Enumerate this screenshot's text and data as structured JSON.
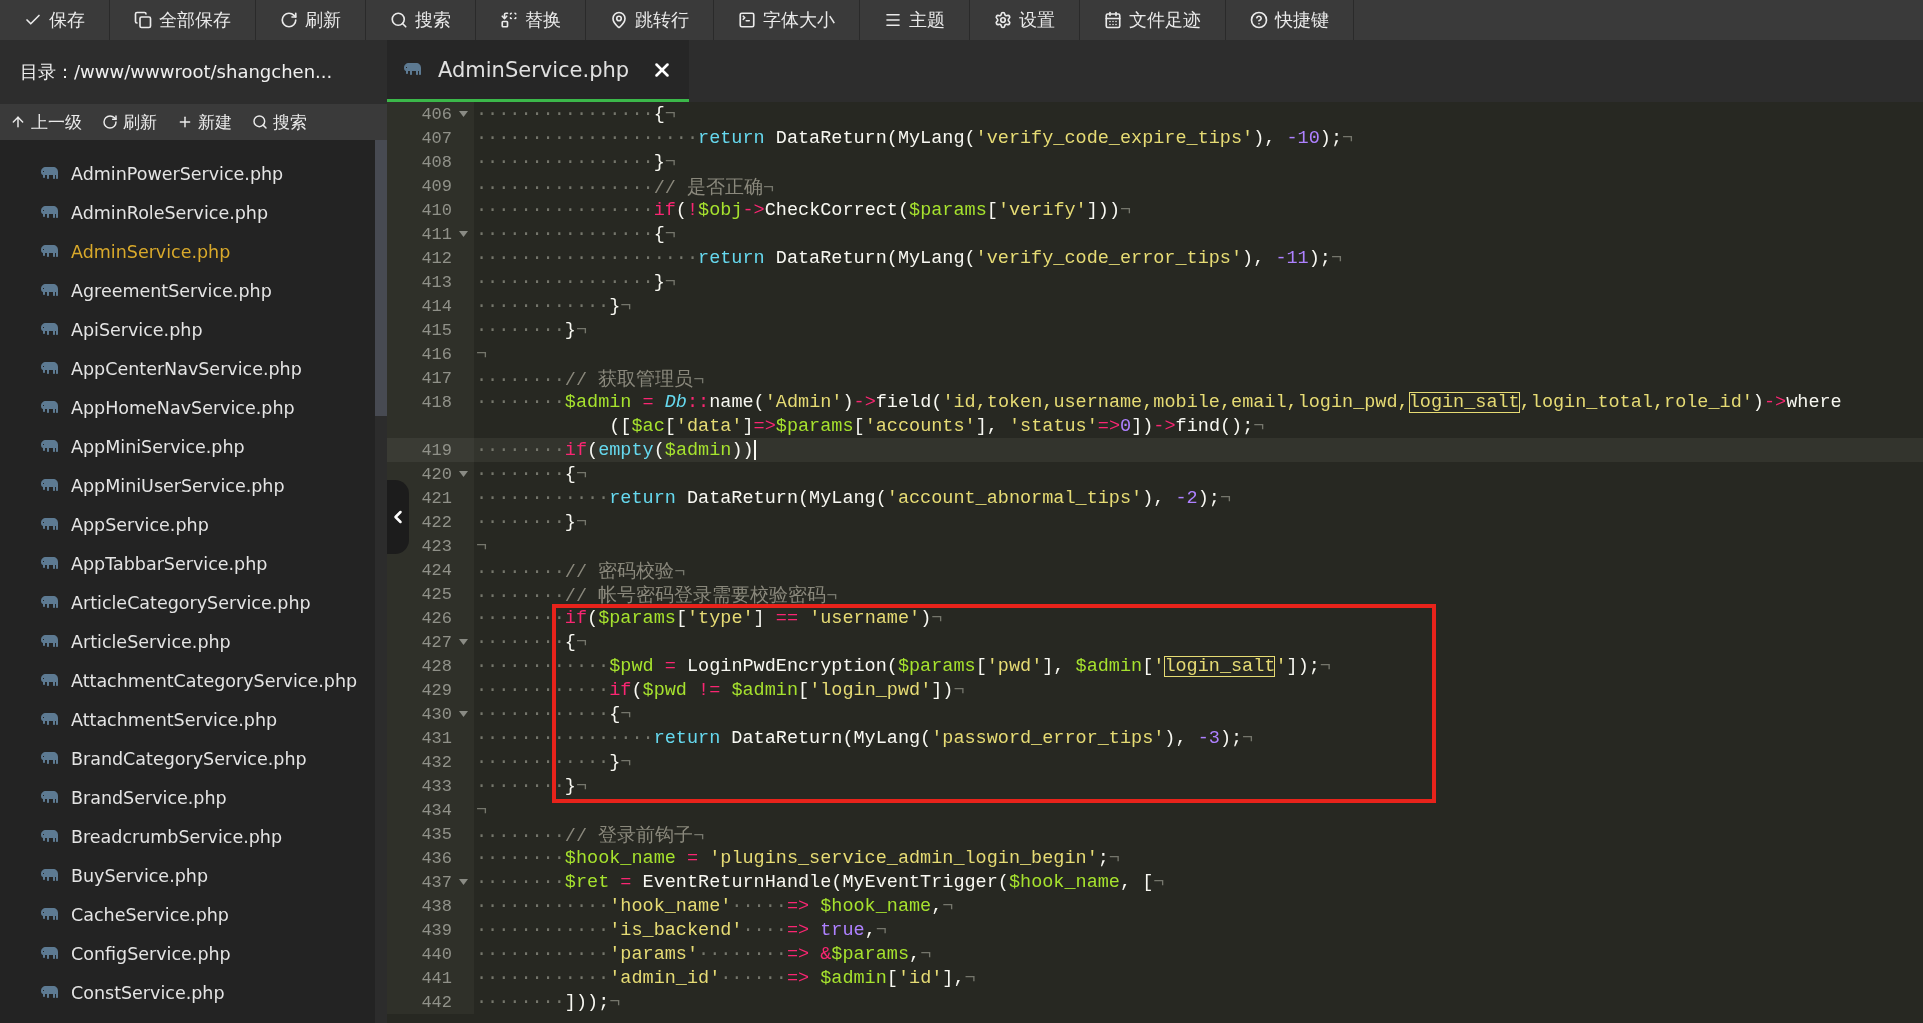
{
  "toolbar": [
    {
      "label": "保存"
    },
    {
      "label": "全部保存"
    },
    {
      "label": "刷新"
    },
    {
      "label": "搜索"
    },
    {
      "label": "替换"
    },
    {
      "label": "跳转行"
    },
    {
      "label": "字体大小"
    },
    {
      "label": "主题"
    },
    {
      "label": "设置"
    },
    {
      "label": "文件足迹"
    },
    {
      "label": "快捷键"
    }
  ],
  "sidebar": {
    "directory": "目录：/www/wwwroot/shangchen...",
    "actions": [
      {
        "label": "上一级"
      },
      {
        "label": "刷新"
      },
      {
        "label": "新建"
      },
      {
        "label": "搜索"
      }
    ],
    "files": [
      {
        "name": "AdminPowerService.php",
        "selected": false
      },
      {
        "name": "AdminRoleService.php",
        "selected": false
      },
      {
        "name": "AdminService.php",
        "selected": true
      },
      {
        "name": "AgreementService.php",
        "selected": false
      },
      {
        "name": "ApiService.php",
        "selected": false
      },
      {
        "name": "AppCenterNavService.php",
        "selected": false
      },
      {
        "name": "AppHomeNavService.php",
        "selected": false
      },
      {
        "name": "AppMiniService.php",
        "selected": false
      },
      {
        "name": "AppMiniUserService.php",
        "selected": false
      },
      {
        "name": "AppService.php",
        "selected": false
      },
      {
        "name": "AppTabbarService.php",
        "selected": false
      },
      {
        "name": "ArticleCategoryService.php",
        "selected": false
      },
      {
        "name": "ArticleService.php",
        "selected": false
      },
      {
        "name": "AttachmentCategoryService.php",
        "selected": false
      },
      {
        "name": "AttachmentService.php",
        "selected": false
      },
      {
        "name": "BrandCategoryService.php",
        "selected": false
      },
      {
        "name": "BrandService.php",
        "selected": false
      },
      {
        "name": "BreadcrumbService.php",
        "selected": false
      },
      {
        "name": "BuyService.php",
        "selected": false
      },
      {
        "name": "CacheService.php",
        "selected": false
      },
      {
        "name": "ConfigService.php",
        "selected": false
      },
      {
        "name": "ConstService.php",
        "selected": false
      }
    ]
  },
  "editor": {
    "tabs": [
      {
        "label": "AdminService.php",
        "selected": true
      }
    ],
    "blocks": [
      {
        "boxed": false,
        "lines": [
          {
            "number": "406",
            "fold": true,
            "current": false,
            "tokens": [
              {
                "text": "················",
                "kind": "ws"
              },
              {
                "text": "{",
                "kind": "p"
              },
              {
                "text": "¬",
                "kind": "eol"
              }
            ]
          },
          {
            "number": "407",
            "fold": false,
            "current": false,
            "tokens": [
              {
                "text": "····················",
                "kind": "ws"
              },
              {
                "text": "return",
                "kind": "fn"
              },
              {
                "text": " DataReturn(MyLang(",
                "kind": "p"
              },
              {
                "text": "'verify_code_expire_tips'",
                "kind": "str"
              },
              {
                "text": "), ",
                "kind": "p"
              },
              {
                "text": "-10",
                "kind": "num"
              },
              {
                "text": ");",
                "kind": "p"
              },
              {
                "text": "¬",
                "kind": "eol"
              }
            ]
          },
          {
            "number": "408",
            "fold": false,
            "current": false,
            "tokens": [
              {
                "text": "················",
                "kind": "ws"
              },
              {
                "text": "}",
                "kind": "p"
              },
              {
                "text": "¬",
                "kind": "eol"
              }
            ]
          },
          {
            "number": "409",
            "fold": false,
            "current": false,
            "tokens": [
              {
                "text": "················",
                "kind": "ws"
              },
              {
                "text": "// 是否正确",
                "kind": "cmt"
              },
              {
                "text": "¬",
                "kind": "eol"
              }
            ]
          },
          {
            "number": "410",
            "fold": false,
            "current": false,
            "tokens": [
              {
                "text": "················",
                "kind": "ws"
              },
              {
                "text": "if",
                "kind": "kw"
              },
              {
                "text": "(",
                "kind": "p"
              },
              {
                "text": "!",
                "kind": "op"
              },
              {
                "text": "$obj",
                "kind": "var"
              },
              {
                "text": "->",
                "kind": "op"
              },
              {
                "text": "CheckCorrect(",
                "kind": "p"
              },
              {
                "text": "$params",
                "kind": "var"
              },
              {
                "text": "[",
                "kind": "p"
              },
              {
                "text": "'verify'",
                "kind": "str"
              },
              {
                "text": "]))",
                "kind": "p"
              },
              {
                "text": "¬",
                "kind": "eol"
              }
            ]
          },
          {
            "number": "411",
            "fold": true,
            "current": false,
            "tokens": [
              {
                "text": "················",
                "kind": "ws"
              },
              {
                "text": "{",
                "kind": "p"
              },
              {
                "text": "¬",
                "kind": "eol"
              }
            ]
          },
          {
            "number": "412",
            "fold": false,
            "current": false,
            "tokens": [
              {
                "text": "····················",
                "kind": "ws"
              },
              {
                "text": "return",
                "kind": "fn"
              },
              {
                "text": " DataReturn(MyLang(",
                "kind": "p"
              },
              {
                "text": "'verify_code_error_tips'",
                "kind": "str"
              },
              {
                "text": "), ",
                "kind": "p"
              },
              {
                "text": "-11",
                "kind": "num"
              },
              {
                "text": ");",
                "kind": "p"
              },
              {
                "text": "¬",
                "kind": "eol"
              }
            ]
          },
          {
            "number": "413",
            "fold": false,
            "current": false,
            "tokens": [
              {
                "text": "················",
                "kind": "ws"
              },
              {
                "text": "}",
                "kind": "p"
              },
              {
                "text": "¬",
                "kind": "eol"
              }
            ]
          },
          {
            "number": "414",
            "fold": false,
            "current": false,
            "tokens": [
              {
                "text": "············",
                "kind": "ws"
              },
              {
                "text": "}",
                "kind": "p"
              },
              {
                "text": "¬",
                "kind": "eol"
              }
            ]
          },
          {
            "number": "415",
            "fold": false,
            "current": false,
            "tokens": [
              {
                "text": "········",
                "kind": "ws"
              },
              {
                "text": "}",
                "kind": "p"
              },
              {
                "text": "¬",
                "kind": "eol"
              }
            ]
          },
          {
            "number": "416",
            "fold": false,
            "current": false,
            "tokens": [
              {
                "text": "¬",
                "kind": "eol"
              }
            ]
          },
          {
            "number": "417",
            "fold": false,
            "current": false,
            "tokens": [
              {
                "text": "········",
                "kind": "ws"
              },
              {
                "text": "// 获取管理员",
                "kind": "cmt"
              },
              {
                "text": "¬",
                "kind": "eol"
              }
            ]
          },
          {
            "number": "418",
            "fold": false,
            "current": false,
            "tokens": [
              {
                "text": "········",
                "kind": "ws"
              },
              {
                "text": "$admin",
                "kind": "var"
              },
              {
                "text": " = ",
                "kind": "op"
              },
              {
                "text": "Db",
                "kind": "cls"
              },
              {
                "text": "::",
                "kind": "op"
              },
              {
                "text": "name(",
                "kind": "p"
              },
              {
                "text": "'Admin'",
                "kind": "str"
              },
              {
                "text": ")",
                "kind": "p"
              },
              {
                "text": "->",
                "kind": "op"
              },
              {
                "text": "field(",
                "kind": "p"
              },
              {
                "text": "'id,token,username,mobile,email,login_pwd,",
                "kind": "str"
              },
              {
                "text": "login_salt",
                "kind": "match"
              },
              {
                "text": ",login_total,role_id'",
                "kind": "str"
              },
              {
                "text": ")",
                "kind": "p"
              },
              {
                "text": "->",
                "kind": "op"
              },
              {
                "text": "where",
                "kind": "p"
              }
            ],
            "continuation": [
              {
                "text": "([",
                "kind": "p"
              },
              {
                "text": "$ac",
                "kind": "var"
              },
              {
                "text": "[",
                "kind": "p"
              },
              {
                "text": "'data'",
                "kind": "str"
              },
              {
                "text": "]",
                "kind": "p"
              },
              {
                "text": "=>",
                "kind": "op"
              },
              {
                "text": "$params",
                "kind": "var"
              },
              {
                "text": "[",
                "kind": "p"
              },
              {
                "text": "'accounts'",
                "kind": "str"
              },
              {
                "text": "], ",
                "kind": "p"
              },
              {
                "text": "'status'",
                "kind": "str"
              },
              {
                "text": "=>",
                "kind": "op"
              },
              {
                "text": "0",
                "kind": "num"
              },
              {
                "text": "])",
                "kind": "p"
              },
              {
                "text": "->",
                "kind": "op"
              },
              {
                "text": "find();",
                "kind": "p"
              },
              {
                "text": "¬",
                "kind": "eol"
              }
            ]
          },
          {
            "number": "419",
            "fold": false,
            "current": true,
            "tokens": [
              {
                "text": "········",
                "kind": "ws"
              },
              {
                "text": "if",
                "kind": "kw"
              },
              {
                "text": "(",
                "kind": "p"
              },
              {
                "text": "empty",
                "kind": "fn"
              },
              {
                "text": "(",
                "kind": "p"
              },
              {
                "text": "$admin",
                "kind": "var"
              },
              {
                "text": "))",
                "kind": "p"
              }
            ]
          },
          {
            "number": "420",
            "fold": true,
            "current": false,
            "tokens": [
              {
                "text": "········",
                "kind": "ws"
              },
              {
                "text": "{",
                "kind": "p"
              },
              {
                "text": "¬",
                "kind": "eol"
              }
            ]
          },
          {
            "number": "421",
            "fold": false,
            "current": false,
            "tokens": [
              {
                "text": "············",
                "kind": "ws"
              },
              {
                "text": "return",
                "kind": "fn"
              },
              {
                "text": " DataReturn(MyLang(",
                "kind": "p"
              },
              {
                "text": "'account_abnormal_tips'",
                "kind": "str"
              },
              {
                "text": "), ",
                "kind": "p"
              },
              {
                "text": "-2",
                "kind": "num"
              },
              {
                "text": ");",
                "kind": "p"
              },
              {
                "text": "¬",
                "kind": "eol"
              }
            ]
          },
          {
            "number": "422",
            "fold": false,
            "current": false,
            "tokens": [
              {
                "text": "········",
                "kind": "ws"
              },
              {
                "text": "}",
                "kind": "p"
              },
              {
                "text": "¬",
                "kind": "eol"
              }
            ]
          },
          {
            "number": "423",
            "fold": false,
            "current": false,
            "tokens": [
              {
                "text": "¬",
                "kind": "eol"
              }
            ]
          },
          {
            "number": "424",
            "fold": false,
            "current": false,
            "tokens": [
              {
                "text": "········",
                "kind": "ws"
              },
              {
                "text": "// 密码校验",
                "kind": "cmt"
              },
              {
                "text": "¬",
                "kind": "eol"
              }
            ]
          },
          {
            "number": "425",
            "fold": false,
            "current": false,
            "tokens": [
              {
                "text": "········",
                "kind": "ws"
              },
              {
                "text": "// 帐号密码登录需要校验密码",
                "kind": "cmt"
              },
              {
                "text": "¬",
                "kind": "eol"
              }
            ]
          }
        ]
      },
      {
        "boxed": true,
        "lines": [
          {
            "number": "426",
            "fold": false,
            "current": false,
            "tokens": [
              {
                "text": "········",
                "kind": "ws"
              },
              {
                "text": "if",
                "kind": "kw"
              },
              {
                "text": "(",
                "kind": "p"
              },
              {
                "text": "$params",
                "kind": "var"
              },
              {
                "text": "[",
                "kind": "p"
              },
              {
                "text": "'type'",
                "kind": "str"
              },
              {
                "text": "] ",
                "kind": "p"
              },
              {
                "text": "== ",
                "kind": "op"
              },
              {
                "text": "'username'",
                "kind": "str"
              },
              {
                "text": ")",
                "kind": "p"
              },
              {
                "text": "¬",
                "kind": "eol"
              }
            ]
          },
          {
            "number": "427",
            "fold": true,
            "current": false,
            "tokens": [
              {
                "text": "········",
                "kind": "ws"
              },
              {
                "text": "{",
                "kind": "p"
              },
              {
                "text": "¬",
                "kind": "eol"
              }
            ]
          },
          {
            "number": "428",
            "fold": false,
            "current": false,
            "tokens": [
              {
                "text": "············",
                "kind": "ws"
              },
              {
                "text": "$pwd",
                "kind": "var"
              },
              {
                "text": " = ",
                "kind": "op"
              },
              {
                "text": "LoginPwdEncryption(",
                "kind": "p"
              },
              {
                "text": "$params",
                "kind": "var"
              },
              {
                "text": "[",
                "kind": "p"
              },
              {
                "text": "'pwd'",
                "kind": "str"
              },
              {
                "text": "], ",
                "kind": "p"
              },
              {
                "text": "$admin",
                "kind": "var"
              },
              {
                "text": "[",
                "kind": "p"
              },
              {
                "text": "'",
                "kind": "str"
              },
              {
                "text": "login_salt",
                "kind": "match"
              },
              {
                "text": "'",
                "kind": "str"
              },
              {
                "text": "]);",
                "kind": "p"
              },
              {
                "text": "¬",
                "kind": "eol"
              }
            ]
          },
          {
            "number": "429",
            "fold": false,
            "current": false,
            "tokens": [
              {
                "text": "············",
                "kind": "ws"
              },
              {
                "text": "if",
                "kind": "kw"
              },
              {
                "text": "(",
                "kind": "p"
              },
              {
                "text": "$pwd",
                "kind": "var"
              },
              {
                "text": " != ",
                "kind": "op"
              },
              {
                "text": "$admin",
                "kind": "var"
              },
              {
                "text": "[",
                "kind": "p"
              },
              {
                "text": "'login_pwd'",
                "kind": "str"
              },
              {
                "text": "])",
                "kind": "p"
              },
              {
                "text": "¬",
                "kind": "eol"
              }
            ]
          },
          {
            "number": "430",
            "fold": true,
            "current": false,
            "tokens": [
              {
                "text": "············",
                "kind": "ws"
              },
              {
                "text": "{",
                "kind": "p"
              },
              {
                "text": "¬",
                "kind": "eol"
              }
            ]
          },
          {
            "number": "431",
            "fold": false,
            "current": false,
            "tokens": [
              {
                "text": "················",
                "kind": "ws"
              },
              {
                "text": "return",
                "kind": "fn"
              },
              {
                "text": " DataReturn(MyLang(",
                "kind": "p"
              },
              {
                "text": "'password_error_tips'",
                "kind": "str"
              },
              {
                "text": "), ",
                "kind": "p"
              },
              {
                "text": "-3",
                "kind": "num"
              },
              {
                "text": ");",
                "kind": "p"
              },
              {
                "text": "¬",
                "kind": "eol"
              }
            ]
          },
          {
            "number": "432",
            "fold": false,
            "current": false,
            "tokens": [
              {
                "text": "············",
                "kind": "ws"
              },
              {
                "text": "}",
                "kind": "p"
              },
              {
                "text": "¬",
                "kind": "eol"
              }
            ]
          },
          {
            "number": "433",
            "fold": false,
            "current": false,
            "tokens": [
              {
                "text": "········",
                "kind": "ws"
              },
              {
                "text": "}",
                "kind": "p"
              },
              {
                "text": "¬",
                "kind": "eol"
              }
            ]
          }
        ]
      },
      {
        "boxed": false,
        "lines": [
          {
            "number": "434",
            "fold": false,
            "current": false,
            "tokens": [
              {
                "text": "¬",
                "kind": "eol"
              }
            ]
          },
          {
            "number": "435",
            "fold": false,
            "current": false,
            "tokens": [
              {
                "text": "········",
                "kind": "ws"
              },
              {
                "text": "// 登录前钩子",
                "kind": "cmt"
              },
              {
                "text": "¬",
                "kind": "eol"
              }
            ]
          },
          {
            "number": "436",
            "fold": false,
            "current": false,
            "tokens": [
              {
                "text": "········",
                "kind": "ws"
              },
              {
                "text": "$hook_name",
                "kind": "var"
              },
              {
                "text": " = ",
                "kind": "op"
              },
              {
                "text": "'plugins_service_admin_login_begin'",
                "kind": "str"
              },
              {
                "text": ";",
                "kind": "p"
              },
              {
                "text": "¬",
                "kind": "eol"
              }
            ]
          },
          {
            "number": "437",
            "fold": true,
            "current": false,
            "tokens": [
              {
                "text": "········",
                "kind": "ws"
              },
              {
                "text": "$ret",
                "kind": "var"
              },
              {
                "text": " = ",
                "kind": "op"
              },
              {
                "text": "EventReturnHandle(MyEventTrigger(",
                "kind": "p"
              },
              {
                "text": "$hook_name",
                "kind": "var"
              },
              {
                "text": ", [",
                "kind": "p"
              },
              {
                "text": "¬",
                "kind": "eol"
              }
            ]
          },
          {
            "number": "438",
            "fold": false,
            "current": false,
            "tokens": [
              {
                "text": "············",
                "kind": "ws"
              },
              {
                "text": "'hook_name'",
                "kind": "str"
              },
              {
                "text": "·····",
                "kind": "ws"
              },
              {
                "text": "=> ",
                "kind": "op"
              },
              {
                "text": "$hook_name",
                "kind": "var"
              },
              {
                "text": ",",
                "kind": "p"
              },
              {
                "text": "¬",
                "kind": "eol"
              }
            ]
          },
          {
            "number": "439",
            "fold": false,
            "current": false,
            "tokens": [
              {
                "text": "············",
                "kind": "ws"
              },
              {
                "text": "'is_backend'",
                "kind": "str"
              },
              {
                "text": "····",
                "kind": "ws"
              },
              {
                "text": "=> ",
                "kind": "op"
              },
              {
                "text": "true",
                "kind": "num"
              },
              {
                "text": ",",
                "kind": "p"
              },
              {
                "text": "¬",
                "kind": "eol"
              }
            ]
          },
          {
            "number": "440",
            "fold": false,
            "current": false,
            "tokens": [
              {
                "text": "············",
                "kind": "ws"
              },
              {
                "text": "'params'",
                "kind": "str"
              },
              {
                "text": "········",
                "kind": "ws"
              },
              {
                "text": "=> &",
                "kind": "op"
              },
              {
                "text": "$params",
                "kind": "var"
              },
              {
                "text": ",",
                "kind": "p"
              },
              {
                "text": "¬",
                "kind": "eol"
              }
            ]
          },
          {
            "number": "441",
            "fold": false,
            "current": false,
            "tokens": [
              {
                "text": "············",
                "kind": "ws"
              },
              {
                "text": "'admin_id'",
                "kind": "str"
              },
              {
                "text": "······",
                "kind": "ws"
              },
              {
                "text": "=> ",
                "kind": "op"
              },
              {
                "text": "$admin",
                "kind": "var"
              },
              {
                "text": "[",
                "kind": "p"
              },
              {
                "text": "'id'",
                "kind": "str"
              },
              {
                "text": "],",
                "kind": "p"
              },
              {
                "text": "¬",
                "kind": "eol"
              }
            ]
          },
          {
            "number": "442",
            "fold": false,
            "current": false,
            "tokens": [
              {
                "text": "········",
                "kind": "ws"
              },
              {
                "text": "]));",
                "kind": "p"
              },
              {
                "text": "¬",
                "kind": "eol"
              }
            ]
          }
        ]
      }
    ]
  }
}
